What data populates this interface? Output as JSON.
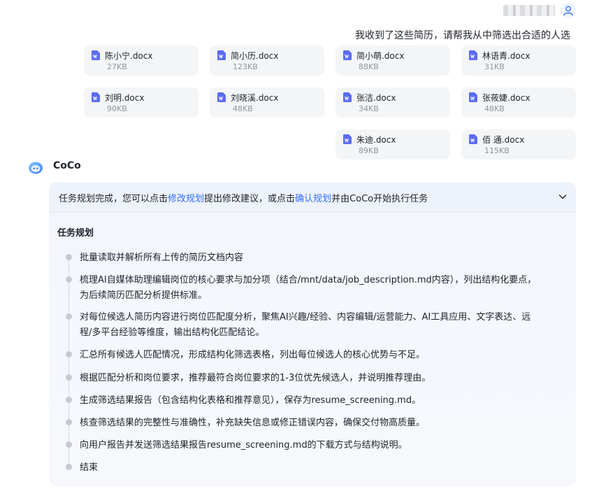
{
  "user_message": "我收到了这些简历，请帮我从中筛选出合适的人选",
  "files": [
    {
      "name": "陈小宁.docx",
      "size": "27KB"
    },
    {
      "name": "简小历.docx",
      "size": "123KB"
    },
    {
      "name": "简小萌.docx",
      "size": "88KB"
    },
    {
      "name": "林语青.docx",
      "size": "31KB"
    },
    {
      "name": "刘明.docx",
      "size": "90KB"
    },
    {
      "name": "刘晓溪.docx",
      "size": "48KB"
    },
    {
      "name": "张洁.docx",
      "size": "34KB"
    },
    {
      "name": "张莜婕.docx",
      "size": "48KB"
    },
    {
      "name": "朱迪.docx",
      "size": "89KB"
    },
    {
      "name": "佰 通.docx",
      "size": "115KB"
    }
  ],
  "bot": {
    "name": "CoCo"
  },
  "banner": {
    "part1": "任务规划完成，您可以点击",
    "link_modify": "修改规划",
    "part2": "提出修改建议，或点击",
    "link_confirm": "确认规划",
    "part3": "并由CoCo开始执行任务"
  },
  "plan": {
    "title": "任务规划",
    "steps": [
      "批量读取并解析所有上传的简历文档内容",
      "梳理AI自媒体助理编辑岗位的核心要求与加分项（结合/mnt/data/job_description.md内容），列出结构化要点，为后续简历匹配分析提供标准。",
      "对每位候选人简历内容进行岗位匹配度分析，聚焦AI兴趣/经验、内容编辑/运营能力、AI工具应用、文字表达、远程/多平台经验等维度，输出结构化匹配结论。",
      "汇总所有候选人匹配情况，形成结构化筛选表格，列出每位候选人的核心优势与不足。",
      "根据匹配分析和岗位要求，推荐最符合岗位要求的1-3位优先候选人，并说明推荐理由。",
      "生成筛选结果报告（包含结构化表格和推荐意见），保存为resume_screening.md。",
      "核查筛选结果的完整性与准确性，补充缺失信息或修正错误内容，确保交付物高质量。",
      "向用户报告并发送筛选结果报告resume_screening.md的下载方式与结构说明。",
      "结束"
    ]
  },
  "colors": {
    "accent": "#3370ff",
    "doc_icon": "#5b6cf0",
    "card_bg": "#f4f5f7"
  }
}
